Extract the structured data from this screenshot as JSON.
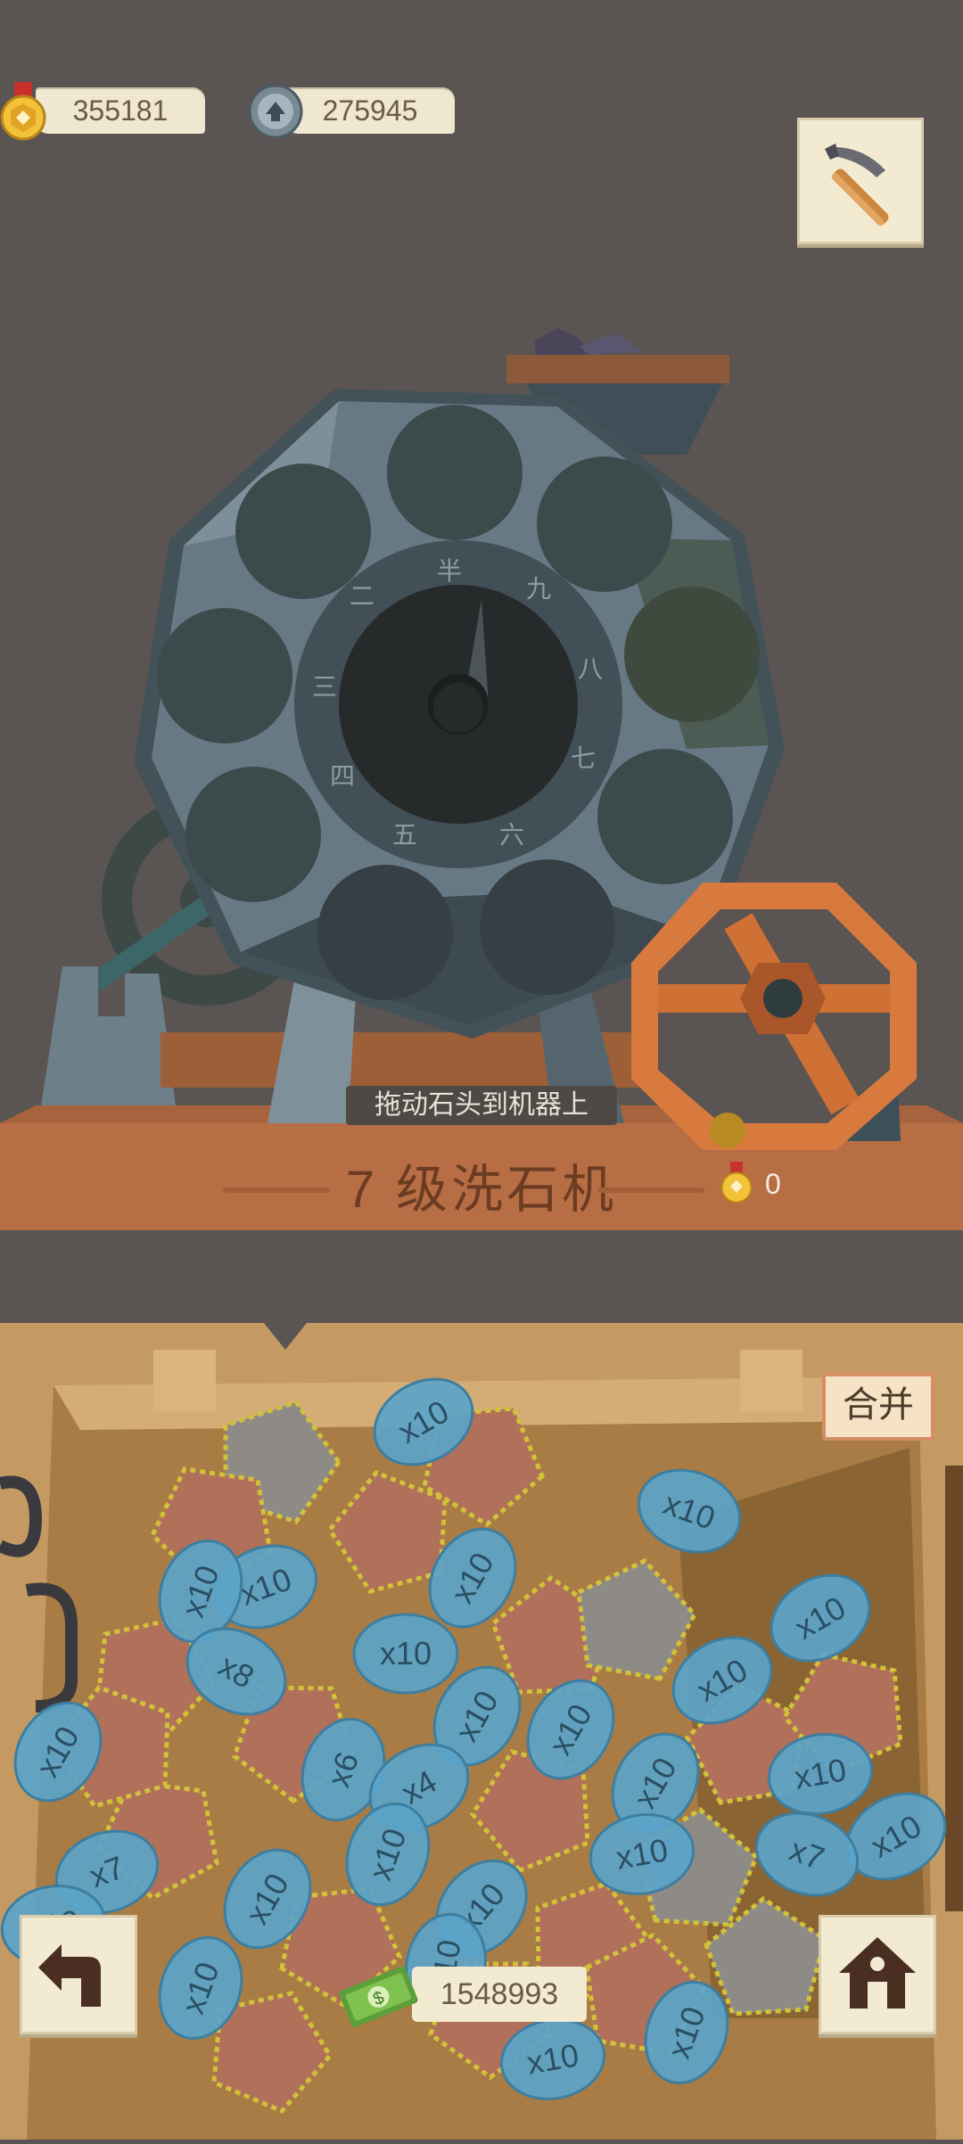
{
  "hud": {
    "medals": "355181",
    "gears": "275945"
  },
  "machine": {
    "hint": "拖动石头到机器上",
    "title": "7 级洗石机",
    "reward_count": "0"
  },
  "board": {
    "merge_label": "合并",
    "cash": "1548993"
  },
  "stones": [
    {
      "label": "x10"
    },
    {
      "label": "x10"
    },
    {
      "label": "x10"
    },
    {
      "label": "x10"
    },
    {
      "label": "x10"
    },
    {
      "label": "x10"
    },
    {
      "label": "x10"
    },
    {
      "label": "x8"
    },
    {
      "label": "x10"
    },
    {
      "label": "x10"
    },
    {
      "label": "x10"
    },
    {
      "label": "x10"
    },
    {
      "label": "x6"
    },
    {
      "label": "x4"
    },
    {
      "label": "x10"
    },
    {
      "label": "x10"
    },
    {
      "label": "x7"
    },
    {
      "label": "x10"
    },
    {
      "label": "x10"
    },
    {
      "label": "x7"
    },
    {
      "label": "x10"
    },
    {
      "label": "x10"
    },
    {
      "label": "x10"
    },
    {
      "label": "x10"
    },
    {
      "label": "x10"
    },
    {
      "label": "x10"
    },
    {
      "label": "x10"
    },
    {
      "label": "x10"
    }
  ],
  "icons": {
    "medal": "medal-icon",
    "gear_coin": "gear-coin-icon",
    "pickaxe": "pickaxe-icon",
    "back": "back-arrow-icon",
    "home": "home-icon",
    "cash": "cash-icon"
  },
  "colors": {
    "background": "#5a5452",
    "crate": "#c49a62",
    "stone_blue": "#5ba4c9",
    "stone_brown": "#b0705a",
    "wood": "#b86e45",
    "accent_orange": "#d87a3e"
  }
}
